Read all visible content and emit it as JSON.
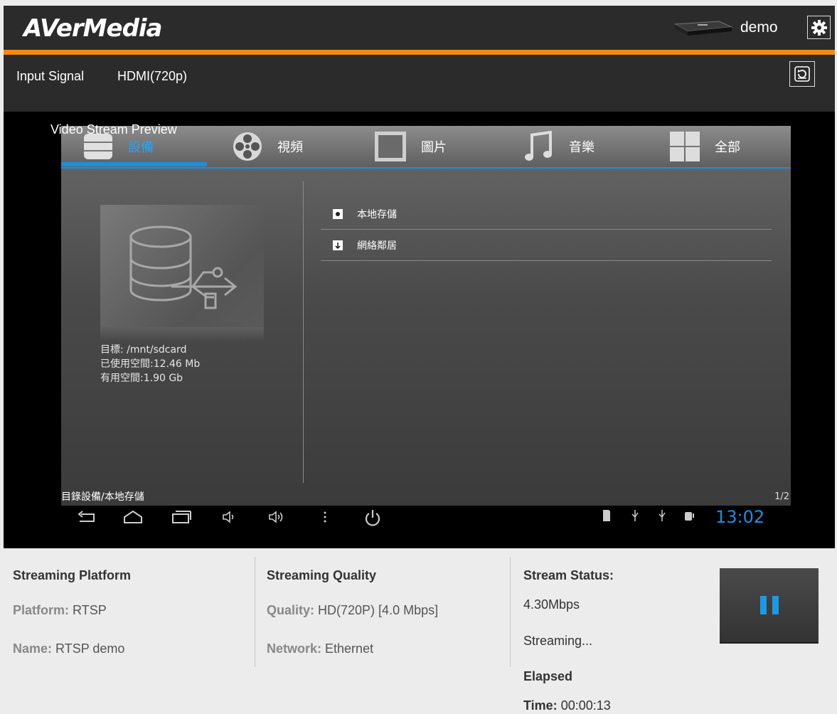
{
  "header": {
    "logo": "AVerMedia",
    "user": "demo",
    "device_icon": "streaming-box",
    "settings_icon": "gear",
    "accent_color": "#f28a10"
  },
  "signal": {
    "label": "Input Signal",
    "value": "HDMI(720p)",
    "refresh_icon": "refresh"
  },
  "preview": {
    "label": "Video Stream Preview",
    "tabs": [
      {
        "label": "設備",
        "icon": "database",
        "active": true
      },
      {
        "label": "視頻",
        "icon": "film-reel",
        "active": false
      },
      {
        "label": "圖片",
        "icon": "picture-frame",
        "active": false
      },
      {
        "label": "音樂",
        "icon": "music-note",
        "active": false
      },
      {
        "label": "全部",
        "icon": "grid",
        "active": false
      }
    ],
    "storage_info": [
      "目標: /mnt/sdcard",
      "已使用空間:12.46 Mb",
      "有用空間:1.90 Gb"
    ],
    "list": [
      {
        "label": "本地存儲",
        "icon": "local-storage"
      },
      {
        "label": "網絡鄰居",
        "icon": "network-neighbor"
      }
    ],
    "path": "目錄設備/本地存儲",
    "page": "1/2",
    "clock": "13:02"
  },
  "streaming_platform": {
    "heading": "Streaming Platform",
    "platform_key": "Platform:",
    "platform_value": "RTSP",
    "name_key": "Name:",
    "name_value": "RTSP demo"
  },
  "streaming_quality": {
    "heading": "Streaming Quality",
    "quality_key": "Quality:",
    "quality_value": "HD(720P) [4.0 Mbps]",
    "network_key": "Network:",
    "network_value": "Ethernet"
  },
  "stream_status": {
    "heading": "Stream Status:",
    "bitrate": "4.30Mbps",
    "state": "Streaming...",
    "elapsed_label": "Elapsed",
    "time_key": "Time:",
    "time_value": "00:00:13",
    "pause_icon": "pause",
    "pause_color": "#1a9ae6"
  }
}
